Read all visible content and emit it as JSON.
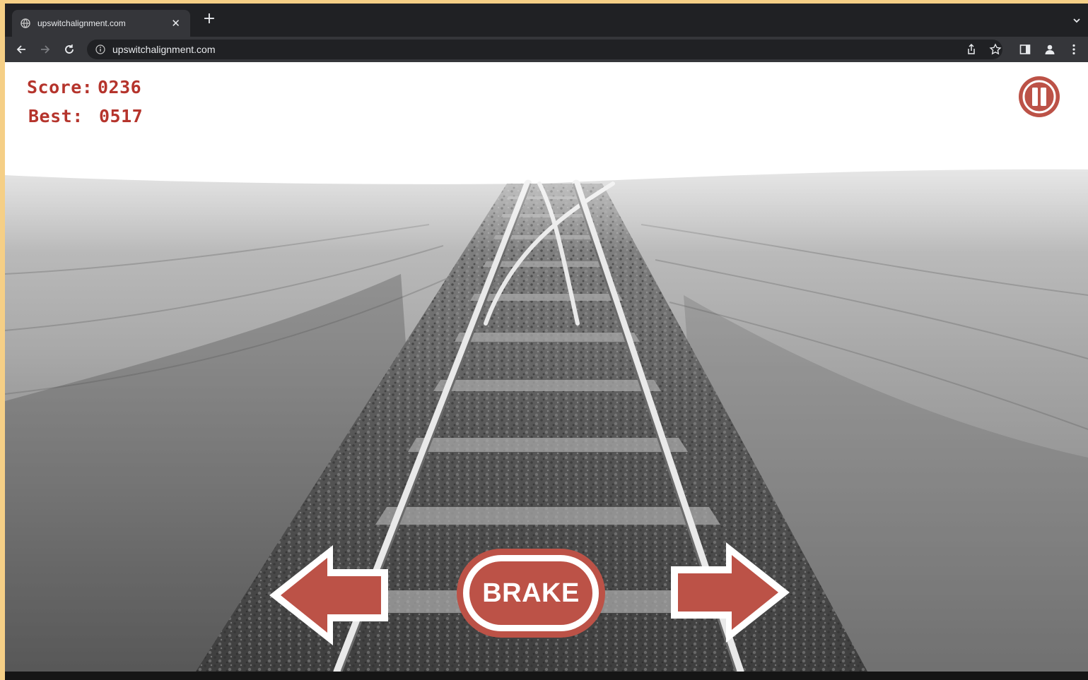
{
  "browser": {
    "tab_title": "upswitchalignment.com",
    "url": "upswitchalignment.com"
  },
  "hud": {
    "score_label": "Score:",
    "score_value": "0236",
    "best_label": "Best:",
    "best_value": "0517"
  },
  "controls": {
    "brake_label": "BRAKE",
    "accent_color": "#bc5247"
  },
  "icons": [
    "globe-icon",
    "close-icon",
    "plus-icon",
    "chevron-down-icon",
    "back-icon",
    "forward-icon",
    "reload-icon",
    "info-icon",
    "share-icon",
    "star-icon",
    "sidepanel-icon",
    "profile-icon",
    "menu-icon",
    "pause-icon",
    "left-arrow-icon",
    "right-arrow-icon"
  ]
}
